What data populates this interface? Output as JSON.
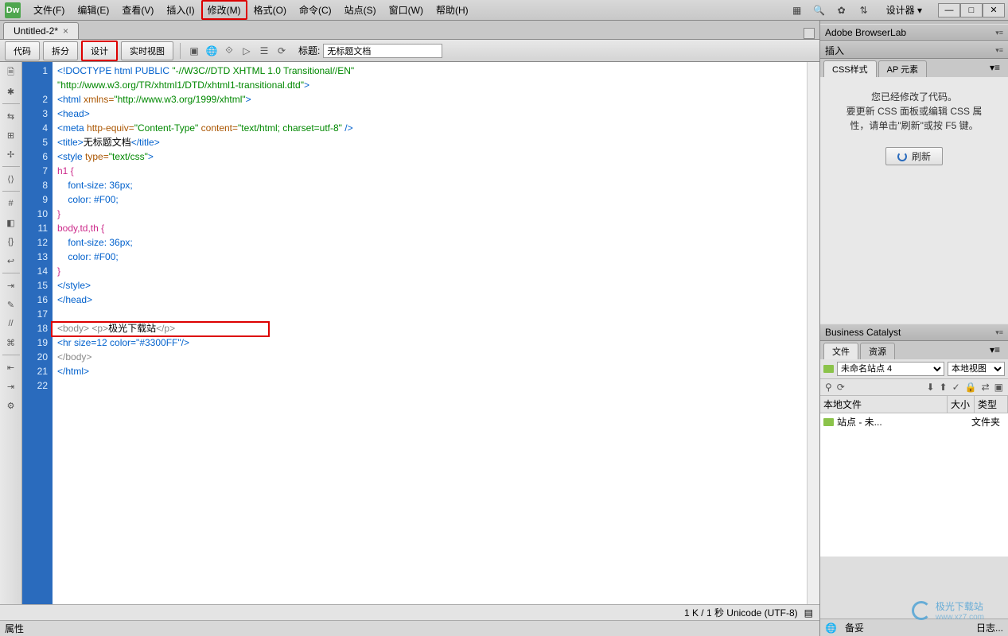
{
  "title_logo": "Dw",
  "menu": [
    "文件(F)",
    "编辑(E)",
    "查看(V)",
    "插入(I)",
    "修改(M)",
    "格式(O)",
    "命令(C)",
    "站点(S)",
    "窗口(W)",
    "帮助(H)"
  ],
  "menu_highlight": 4,
  "designer": "设计器",
  "doc_tab": "Untitled-2*",
  "view_buttons": {
    "code": "代码",
    "split": "拆分",
    "design": "设计",
    "live": "实时视图"
  },
  "title_label": "标题:",
  "title_value": "无标题文档",
  "code_lines": [
    {
      "n": 1,
      "segs": [
        {
          "t": "<!DOCTYPE html PUBLIC ",
          "c": "c-blue"
        },
        {
          "t": "\"-//W3C//DTD XHTML 1.0 Transitional//EN\"",
          "c": "c-green"
        }
      ]
    },
    {
      "n": 2,
      "segs": [
        {
          "t": "\"http://www.w3.org/TR/xhtml1/DTD/xhtml1-transitional.dtd\"",
          "c": "c-green"
        },
        {
          "t": ">",
          "c": "c-blue"
        }
      ],
      "indent": 0,
      "prefix": ""
    },
    {
      "n": 2,
      "real": true,
      "segs": [
        {
          "t": "<html ",
          "c": "c-blue"
        },
        {
          "t": "xmlns=",
          "c": "c-brown"
        },
        {
          "t": "\"http://www.w3.org/1999/xhtml\"",
          "c": "c-green"
        },
        {
          "t": ">",
          "c": "c-blue"
        }
      ]
    },
    {
      "n": 3,
      "segs": [
        {
          "t": "<head>",
          "c": "c-blue"
        }
      ]
    },
    {
      "n": 4,
      "segs": [
        {
          "t": "<meta ",
          "c": "c-blue"
        },
        {
          "t": "http-equiv=",
          "c": "c-brown"
        },
        {
          "t": "\"Content-Type\" ",
          "c": "c-green"
        },
        {
          "t": "content=",
          "c": "c-brown"
        },
        {
          "t": "\"text/html; charset=utf-8\" ",
          "c": "c-green"
        },
        {
          "t": "/>",
          "c": "c-blue"
        }
      ]
    },
    {
      "n": 5,
      "segs": [
        {
          "t": "<title>",
          "c": "c-blue"
        },
        {
          "t": "无标题文档",
          "c": "c-black"
        },
        {
          "t": "</title>",
          "c": "c-blue"
        }
      ]
    },
    {
      "n": 6,
      "segs": [
        {
          "t": "<style ",
          "c": "c-blue"
        },
        {
          "t": "type=",
          "c": "c-brown"
        },
        {
          "t": "\"text/css\"",
          "c": "c-green"
        },
        {
          "t": ">",
          "c": "c-blue"
        }
      ]
    },
    {
      "n": 7,
      "segs": [
        {
          "t": "h1 {",
          "c": "c-pink"
        }
      ]
    },
    {
      "n": 8,
      "segs": [
        {
          "t": "    font-size: 36px;",
          "c": "c-blue"
        }
      ]
    },
    {
      "n": 9,
      "segs": [
        {
          "t": "    color: #F00;",
          "c": "c-blue"
        }
      ]
    },
    {
      "n": 10,
      "segs": [
        {
          "t": "}",
          "c": "c-pink"
        }
      ]
    },
    {
      "n": 11,
      "segs": [
        {
          "t": "body,td,th {",
          "c": "c-pink"
        }
      ]
    },
    {
      "n": 12,
      "segs": [
        {
          "t": "    font-size: 36px;",
          "c": "c-blue"
        }
      ]
    },
    {
      "n": 13,
      "segs": [
        {
          "t": "    color: #F00;",
          "c": "c-blue"
        }
      ]
    },
    {
      "n": 14,
      "segs": [
        {
          "t": "}",
          "c": "c-pink"
        }
      ]
    },
    {
      "n": 15,
      "segs": [
        {
          "t": "</style>",
          "c": "c-blue"
        }
      ]
    },
    {
      "n": 16,
      "segs": [
        {
          "t": "</head>",
          "c": "c-blue"
        }
      ]
    },
    {
      "n": 17,
      "segs": [
        {
          "t": "",
          "c": ""
        }
      ]
    },
    {
      "n": 18,
      "segs": [
        {
          "t": "<body> <p>",
          "c": "c-gray"
        },
        {
          "t": "极光下载站",
          "c": "c-black"
        },
        {
          "t": "</p>",
          "c": "c-gray"
        }
      ]
    },
    {
      "n": 19,
      "segs": [
        {
          "t": "<hr size=12 color=\"#3300FF\"/>",
          "c": "c-blue"
        }
      ]
    },
    {
      "n": 20,
      "segs": [
        {
          "t": "</body>",
          "c": "c-gray"
        }
      ]
    },
    {
      "n": 21,
      "segs": [
        {
          "t": "</html>",
          "c": "c-blue"
        }
      ]
    },
    {
      "n": 22,
      "segs": [
        {
          "t": "",
          "c": ""
        }
      ]
    }
  ],
  "status_info": "1 K / 1 秒 Unicode (UTF-8)",
  "prop_label": "属性",
  "panels": {
    "browserlab": "Adobe BrowserLab",
    "insert": "插入",
    "css": "CSS样式",
    "ap": "AP 元素",
    "css_msg1": "您已经修改了代码。",
    "css_msg2": "要更新 CSS  面板或编辑 CSS 属",
    "css_msg3": "性，请单击\"刷新\"或按 F5 键。",
    "refresh": "刷新",
    "bc": "Business Catalyst",
    "files": "文件",
    "assets": "资源",
    "site": "未命名站点 4",
    "view": "本地视图",
    "col1": "本地文件",
    "col2": "大小",
    "col3": "类型",
    "row1": "站点 - 未...",
    "row1t": "文件夹",
    "ready": "备妥",
    "log": "日志..."
  },
  "watermark": {
    "text": "极光下载站",
    "url": "www.xz7.com"
  }
}
